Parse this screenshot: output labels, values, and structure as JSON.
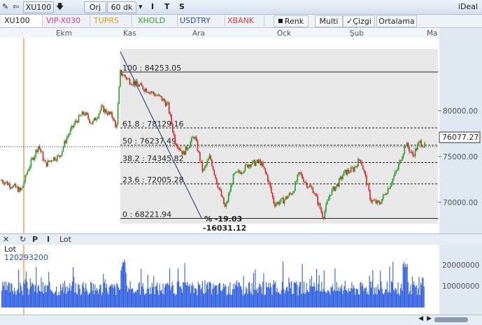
{
  "toolbar": {
    "symbol": "XU100",
    "mode": "Orj",
    "period": "60 dk",
    "buttons": [
      "I",
      "T",
      "S"
    ],
    "app_name": "iDeal"
  },
  "tabs": [
    {
      "label": "XU100",
      "color": "#222222"
    },
    {
      "label": "VIP-X030",
      "color": "#d33c8a"
    },
    {
      "label": "TUPRS",
      "color": "#d8a01c"
    },
    {
      "label": "XHOLD",
      "color": "#2aa22a"
    },
    {
      "label": "USDTRY",
      "color": "#2b4bb7"
    },
    {
      "label": "XBANK",
      "color": "#d63b3b"
    }
  ],
  "options": {
    "renk": "Renk",
    "multi": "Multi",
    "cizgi": "Çizgi",
    "cizgi_checked": true,
    "ortalama": "Ortalama"
  },
  "chart_data": {
    "type": "candlestick",
    "x_labels": [
      "Ekm",
      "Kas",
      "Ara",
      "Ock",
      "Şub",
      "Ma"
    ],
    "y_ticks": [
      "80000.00",
      "75000.00",
      "70000.00"
    ],
    "y_range": [
      66500,
      88000
    ],
    "last_price": "76077.27",
    "fibonacci": [
      {
        "level": "100",
        "value": "84253.05",
        "v": 84253.05
      },
      {
        "level": "61.8",
        "value": "78129.16",
        "v": 78129.16
      },
      {
        "level": "50",
        "value": "76237.49",
        "v": 76237.49
      },
      {
        "level": "38.2",
        "value": "74345.82",
        "v": 74345.82
      },
      {
        "level": "23.6",
        "value": "72005.28",
        "v": 72005.28
      },
      {
        "level": "0",
        "value": "68221.94",
        "v": 68221.94
      }
    ],
    "trend_percent": "% -19.03",
    "trend_points": "-16031.12",
    "up_color": "#1e9a1e",
    "down_color": "#d81e1e"
  },
  "volume": {
    "title": "Lot",
    "last_value": "120293200",
    "y_ticks": [
      "20000000",
      "10000000"
    ],
    "bar_color": "#2f5fe0",
    "buttons": [
      "↻",
      "P",
      "I",
      "Lot"
    ]
  }
}
